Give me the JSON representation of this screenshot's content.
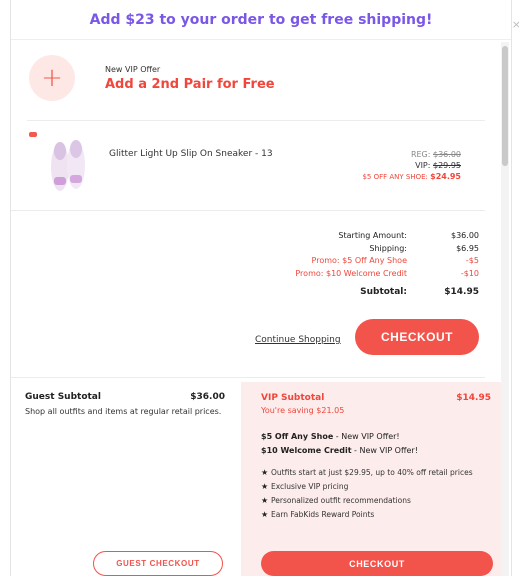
{
  "banner": {
    "text": "Add $23 to your order to get free shipping!",
    "color": "#7a57e6"
  },
  "close": {
    "glyph": "×"
  },
  "vip_offer": {
    "icon": "plus-icon",
    "small": "New VIP Offer",
    "big": "Add a 2nd Pair for Free"
  },
  "item": {
    "name": "Glitter Light Up Slip On Sneaker - 13",
    "reg_label": "REG:",
    "reg_price": "$36.00",
    "vip_label": "VIP:",
    "vip_price": "$29.95",
    "promo_label": "$5 OFF ANY SHOE:",
    "promo_price": "$24.95"
  },
  "totals": {
    "rows": [
      {
        "label": "Starting Amount:",
        "value": "$36.00"
      },
      {
        "label": "Shipping:",
        "value": "$6.95"
      },
      {
        "label": "Promo: $5 Off Any Shoe",
        "value": "-$5"
      },
      {
        "label": "Promo: $10 Welcome Credit",
        "value": "-$10"
      }
    ],
    "subtotal_label": "Subtotal:",
    "subtotal_value": "$14.95"
  },
  "actions": {
    "continue": "Continue Shopping",
    "checkout": "CHECKOUT"
  },
  "guest": {
    "title": "Guest Subtotal",
    "amount": "$36.00",
    "desc": "Shop all outfits and items at regular retail prices.",
    "button": "GUEST CHECKOUT"
  },
  "vip": {
    "title": "VIP Subtotal",
    "amount": "$14.95",
    "saving": "You're saving $21.05",
    "offer1_bold": "$5 Off Any Shoe",
    "offer1_rest": " - New VIP Offer!",
    "offer2_bold": "$10 Welcome Credit",
    "offer2_rest": " - New VIP Offer!",
    "benefits": [
      "Outfits start at just $29.95, up to 40% off retail prices",
      "Exclusive VIP pricing",
      "Personalized outfit recommendations",
      "Earn FabKids Reward Points"
    ],
    "button": "CHECKOUT"
  },
  "colors": {
    "accent": "#f2534b",
    "vip_bg": "#fdecec"
  }
}
